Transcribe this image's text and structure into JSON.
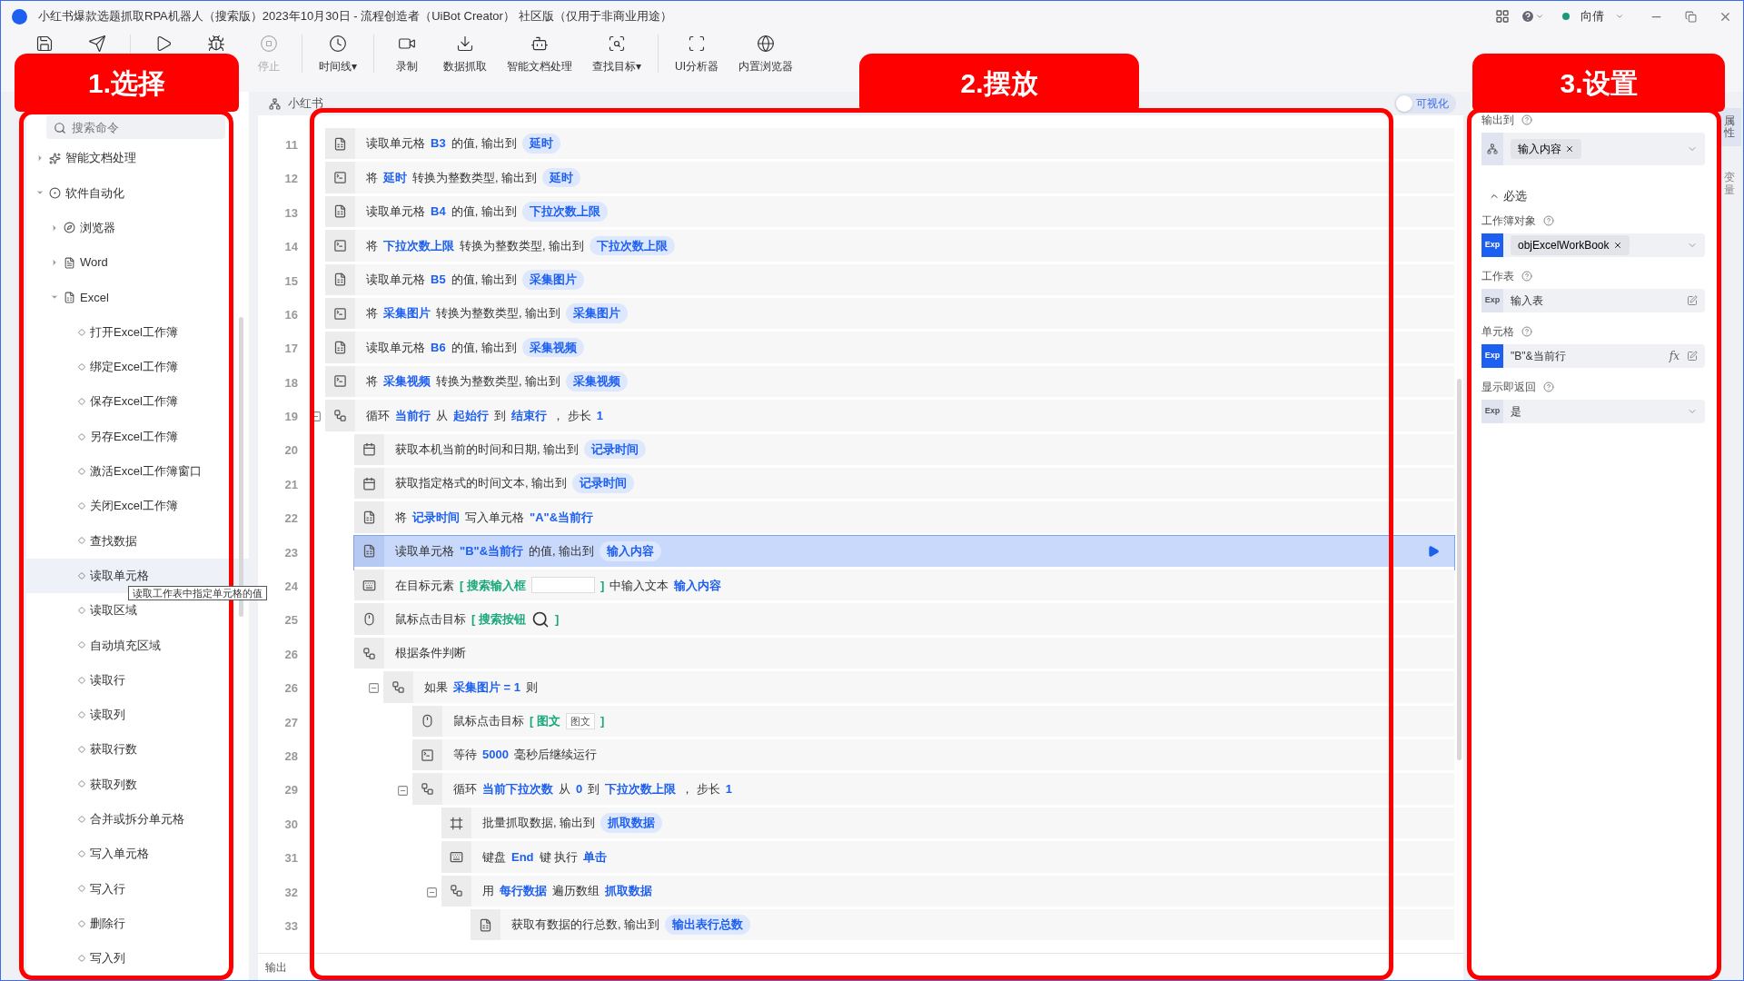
{
  "window": {
    "title": "小红书爆款选题抓取RPA机器人（搜索版）2023年10月30日 - 流程创造者（UiBot Creator） 社区版（仅用于非商业用途）",
    "user": "向倩"
  },
  "toolbar": [
    {
      "kind": "save",
      "disabled": false
    },
    {
      "kind": "send",
      "disabled": false
    },
    {
      "kind": "run",
      "disabled": false
    },
    {
      "kind": "debug",
      "disabled": false
    },
    {
      "kind": "stop",
      "label": "停止",
      "disabled": true
    },
    {
      "kind": "timeline",
      "label": "时间线▾",
      "disabled": false
    },
    {
      "kind": "record",
      "label": "录制",
      "disabled": false
    },
    {
      "kind": "grab",
      "label": "数据抓取",
      "disabled": false
    },
    {
      "kind": "ai",
      "label": "智能文档处理",
      "disabled": false
    },
    {
      "kind": "find",
      "label": "查找目标▾",
      "disabled": false
    },
    {
      "kind": "ui",
      "label": "UI分析器",
      "disabled": false
    },
    {
      "kind": "browser",
      "label": "内置浏览器",
      "disabled": false
    }
  ],
  "annotations": [
    {
      "label": "1.选择"
    },
    {
      "label": "2.摆放"
    },
    {
      "label": "3.设置"
    }
  ],
  "command_panel": {
    "search": {
      "placeholder": "搜索命令"
    },
    "tree": [
      {
        "label": "智能文档处理",
        "kind": "ai",
        "expanded": false,
        "selected": false
      },
      {
        "label": "软件自动化",
        "kind": "auto",
        "expanded": true,
        "selected": false,
        "children": [
          {
            "label": "浏览器",
            "kind": "browser",
            "expanded": false,
            "selected": false
          },
          {
            "label": "Word",
            "kind": "word",
            "expanded": false,
            "selected": false
          },
          {
            "label": "Excel",
            "kind": "excel",
            "expanded": true,
            "selected": false,
            "children": [
              {
                "label": "打开Excel工作簿",
                "kind": "command",
                "selected": false
              },
              {
                "label": "绑定Excel工作簿",
                "kind": "command",
                "selected": false
              },
              {
                "label": "保存Excel工作簿",
                "kind": "command",
                "selected": false
              },
              {
                "label": "另存Excel工作簿",
                "kind": "command",
                "selected": false
              },
              {
                "label": "激活Excel工作簿窗口",
                "kind": "command",
                "selected": false
              },
              {
                "label": "关闭Excel工作簿",
                "kind": "command",
                "selected": false
              },
              {
                "label": "查找数据",
                "kind": "command",
                "selected": false
              },
              {
                "label": "读取单元格",
                "kind": "command",
                "selected": true
              },
              {
                "label": "读取区域",
                "kind": "command",
                "selected": false
              },
              {
                "label": "自动填充区域",
                "kind": "command",
                "selected": false
              },
              {
                "label": "读取行",
                "kind": "command",
                "selected": false
              },
              {
                "label": "读取列",
                "kind": "command",
                "selected": false
              },
              {
                "label": "获取行数",
                "kind": "command",
                "selected": false
              },
              {
                "label": "获取列数",
                "kind": "command",
                "selected": false
              },
              {
                "label": "合并或拆分单元格",
                "kind": "command",
                "selected": false
              },
              {
                "label": "写入单元格",
                "kind": "command",
                "selected": false
              },
              {
                "label": "写入行",
                "kind": "command",
                "selected": false
              },
              {
                "label": "删除行",
                "kind": "command",
                "selected": false
              },
              {
                "label": "写入列",
                "kind": "command",
                "selected": false
              }
            ]
          }
        ]
      }
    ],
    "tooltip": "读取工作表中指定单元格的值"
  },
  "editor": {
    "tab": "小红书",
    "visual_toggle": {
      "label": "可视化",
      "on": false
    },
    "steps": [
      {
        "no": "11",
        "kind": "cell",
        "selected": false,
        "parts": [
          {
            "t": "读取单元格",
            "kind": "text"
          },
          {
            "t": "B3",
            "kind": "var"
          },
          {
            "t": "的值, 输出到",
            "kind": "text"
          },
          {
            "t": "延时",
            "kind": "pill"
          }
        ]
      },
      {
        "no": "12",
        "kind": "convert",
        "selected": false,
        "parts": [
          {
            "t": "将",
            "kind": "text"
          },
          {
            "t": "延时",
            "kind": "var"
          },
          {
            "t": "转换为整数类型, 输出到",
            "kind": "text"
          },
          {
            "t": "延时",
            "kind": "pill"
          }
        ]
      },
      {
        "no": "13",
        "kind": "cell",
        "selected": false,
        "parts": [
          {
            "t": "读取单元格",
            "kind": "text"
          },
          {
            "t": "B4",
            "kind": "var"
          },
          {
            "t": "的值, 输出到",
            "kind": "text"
          },
          {
            "t": "下拉次数上限",
            "kind": "pill"
          }
        ]
      },
      {
        "no": "14",
        "kind": "convert",
        "selected": false,
        "parts": [
          {
            "t": "将",
            "kind": "text"
          },
          {
            "t": "下拉次数上限",
            "kind": "var"
          },
          {
            "t": "转换为整数类型, 输出到",
            "kind": "text"
          },
          {
            "t": "下拉次数上限",
            "kind": "pill"
          }
        ]
      },
      {
        "no": "15",
        "kind": "cell",
        "selected": false,
        "parts": [
          {
            "t": "读取单元格",
            "kind": "text"
          },
          {
            "t": "B5",
            "kind": "var"
          },
          {
            "t": "的值, 输出到",
            "kind": "text"
          },
          {
            "t": "采集图片",
            "kind": "pill"
          }
        ]
      },
      {
        "no": "16",
        "kind": "convert",
        "selected": false,
        "parts": [
          {
            "t": "将",
            "kind": "text"
          },
          {
            "t": "采集图片",
            "kind": "var"
          },
          {
            "t": "转换为整数类型, 输出到",
            "kind": "text"
          },
          {
            "t": "采集图片",
            "kind": "pill"
          }
        ]
      },
      {
        "no": "17",
        "kind": "cell",
        "selected": false,
        "parts": [
          {
            "t": "读取单元格",
            "kind": "text"
          },
          {
            "t": "B6",
            "kind": "var"
          },
          {
            "t": "的值, 输出到",
            "kind": "text"
          },
          {
            "t": "采集视频",
            "kind": "pill"
          }
        ]
      },
      {
        "no": "18",
        "kind": "convert",
        "selected": false,
        "parts": [
          {
            "t": "将",
            "kind": "text"
          },
          {
            "t": "采集视频",
            "kind": "var"
          },
          {
            "t": "转换为整数类型, 输出到",
            "kind": "text"
          },
          {
            "t": "采集视频",
            "kind": "pill"
          }
        ]
      },
      {
        "no": "19",
        "kind": "flow",
        "selected": false,
        "expanded": true,
        "parts": [
          {
            "t": "循环",
            "kind": "text"
          },
          {
            "t": "当前行",
            "kind": "var"
          },
          {
            "t": "从",
            "kind": "text"
          },
          {
            "t": "起始行",
            "kind": "var"
          },
          {
            "t": "到",
            "kind": "text"
          },
          {
            "t": "结束行",
            "kind": "var"
          },
          {
            "t": "，  步长",
            "kind": "text"
          },
          {
            "t": "1",
            "kind": "var"
          }
        ],
        "children": [
          {
            "no": "20",
            "kind": "calendar",
            "selected": false,
            "parts": [
              {
                "t": "获取本机当前的时间和日期, 输出到",
                "kind": "text"
              },
              {
                "t": "记录时间",
                "kind": "pill"
              }
            ]
          },
          {
            "no": "21",
            "kind": "calendar",
            "selected": false,
            "parts": [
              {
                "t": "获取指定格式的时间文本, 输出到",
                "kind": "text"
              },
              {
                "t": "记录时间",
                "kind": "pill"
              }
            ]
          },
          {
            "no": "22",
            "kind": "cell",
            "selected": false,
            "parts": [
              {
                "t": "将",
                "kind": "text"
              },
              {
                "t": "记录时间",
                "kind": "var"
              },
              {
                "t": "写入单元格",
                "kind": "text"
              },
              {
                "t": "\"A\"&当前行",
                "kind": "var"
              }
            ]
          },
          {
            "no": "23",
            "kind": "cell",
            "selected": true,
            "parts": [
              {
                "t": "读取单元格",
                "kind": "text"
              },
              {
                "t": "\"B\"&当前行",
                "kind": "var"
              },
              {
                "t": "的值, 输出到",
                "kind": "text"
              },
              {
                "t": "输入内容",
                "kind": "pill"
              }
            ]
          },
          {
            "no": "24",
            "kind": "keyboard",
            "selected": false,
            "parts": [
              {
                "t": "在目标元素",
                "kind": "text"
              },
              {
                "t": "[ 搜索输入框",
                "kind": "target"
              },
              {
                "kind": "thumb-blank"
              },
              {
                "t": "]",
                "kind": "target"
              },
              {
                "t": "中输入文本",
                "kind": "text"
              },
              {
                "t": "输入内容",
                "kind": "var"
              }
            ]
          },
          {
            "no": "25",
            "kind": "mouse",
            "selected": false,
            "parts": [
              {
                "t": "鼠标点击目标",
                "kind": "text"
              },
              {
                "t": "[ 搜索按钮",
                "kind": "target"
              },
              {
                "kind": "thumb-search"
              },
              {
                "t": "]",
                "kind": "target"
              }
            ]
          },
          {
            "no": "26",
            "kind": "flow",
            "selected": false,
            "parts": [
              {
                "t": "根据条件判断",
                "kind": "text"
              }
            ],
            "children": [
              {
                "no": "26",
                "kind": "flow",
                "selected": false,
                "expanded": true,
                "parts": [
                  {
                    "t": "如果",
                    "kind": "text"
                  },
                  {
                    "t": "采集图片 = 1",
                    "kind": "var"
                  },
                  {
                    "t": "则",
                    "kind": "text"
                  }
                ],
                "children": [
                  {
                    "no": "27",
                    "kind": "mouse",
                    "selected": false,
                    "parts": [
                      {
                        "t": "鼠标点击目标",
                        "kind": "text"
                      },
                      {
                        "t": "[ 图文",
                        "kind": "target"
                      },
                      {
                        "t": "图文",
                        "kind": "thumb"
                      },
                      {
                        "t": "]",
                        "kind": "target"
                      }
                    ]
                  },
                  {
                    "no": "28",
                    "kind": "convert",
                    "selected": false,
                    "parts": [
                      {
                        "t": "等待",
                        "kind": "text"
                      },
                      {
                        "t": "5000",
                        "kind": "var"
                      },
                      {
                        "t": "毫秒后继续运行",
                        "kind": "text"
                      }
                    ]
                  },
                  {
                    "no": "29",
                    "kind": "flow",
                    "selected": false,
                    "expanded": true,
                    "parts": [
                      {
                        "t": "循环",
                        "kind": "text"
                      },
                      {
                        "t": "当前下拉次数",
                        "kind": "var"
                      },
                      {
                        "t": "从",
                        "kind": "text"
                      },
                      {
                        "t": "0",
                        "kind": "var"
                      },
                      {
                        "t": "到",
                        "kind": "text"
                      },
                      {
                        "t": "下拉次数上限",
                        "kind": "var"
                      },
                      {
                        "t": "，  步长",
                        "kind": "text"
                      },
                      {
                        "t": "1",
                        "kind": "var"
                      }
                    ],
                    "children": [
                      {
                        "no": "30",
                        "kind": "grab",
                        "selected": false,
                        "parts": [
                          {
                            "t": "批量抓取数据, 输出到",
                            "kind": "text"
                          },
                          {
                            "t": "抓取数据",
                            "kind": "pill"
                          }
                        ]
                      },
                      {
                        "no": "31",
                        "kind": "keyboard",
                        "selected": false,
                        "parts": [
                          {
                            "t": "键盘",
                            "kind": "text"
                          },
                          {
                            "t": "End",
                            "kind": "var"
                          },
                          {
                            "t": "键 执行",
                            "kind": "text"
                          },
                          {
                            "t": "单击",
                            "kind": "var"
                          }
                        ]
                      },
                      {
                        "no": "32",
                        "kind": "flow",
                        "selected": false,
                        "expanded": true,
                        "parts": [
                          {
                            "t": "用",
                            "kind": "text"
                          },
                          {
                            "t": "每行数据",
                            "kind": "var"
                          },
                          {
                            "t": "遍历数组",
                            "kind": "text"
                          },
                          {
                            "t": "抓取数据",
                            "kind": "var"
                          }
                        ],
                        "children": [
                          {
                            "no": "33",
                            "kind": "cell",
                            "selected": false,
                            "parts": [
                              {
                                "t": "获取有数据的行总数, 输出到",
                                "kind": "text"
                              },
                              {
                                "t": "输出表行总数",
                                "kind": "pill"
                              }
                            ]
                          }
                        ]
                      }
                    ]
                  }
                ]
              }
            ]
          }
        ]
      }
    ],
    "output_tab": "输出"
  },
  "properties": {
    "fields": [
      {
        "label": "输出到",
        "kind": "output",
        "value": "输入内容",
        "help": true
      },
      {
        "kind": "section",
        "label": "必选",
        "expanded": true
      },
      {
        "label": "工作簿对象",
        "kind": "tag",
        "badge": "Exp",
        "value": "objExcelWorkBook",
        "help": true
      },
      {
        "label": "工作表",
        "kind": "text",
        "badge": "Exp",
        "value": "输入表",
        "help": true
      },
      {
        "label": "单元格",
        "kind": "formula",
        "badge": "Exp",
        "formula_button": "fx",
        "value": "\"B\"&当前行",
        "help": true
      },
      {
        "label": "显示即返回",
        "kind": "select",
        "badge": "Exp",
        "value": "是",
        "help": true
      }
    ]
  },
  "side_tabs": [
    "属性",
    "变量"
  ]
}
